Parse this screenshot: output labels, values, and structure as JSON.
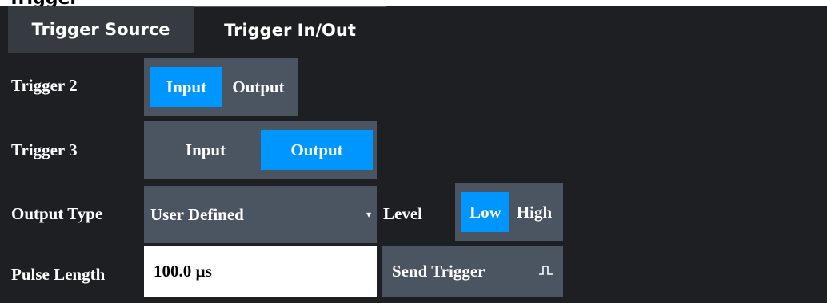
{
  "window": {
    "title_fragment": "Trigger"
  },
  "tabs": [
    {
      "label": "Trigger Source",
      "active": false
    },
    {
      "label": "Trigger In/Out",
      "active": true
    }
  ],
  "trigger2": {
    "label": "Trigger 2",
    "options": [
      "Input",
      "Output"
    ],
    "selected": "Input"
  },
  "trigger3": {
    "label": "Trigger 3",
    "options": [
      "Input",
      "Output"
    ],
    "selected": "Output"
  },
  "output_type": {
    "label": "Output Type",
    "value": "User Defined",
    "caret": "▾"
  },
  "level": {
    "label": "Level",
    "options": [
      "Low",
      "High"
    ],
    "selected": "Low"
  },
  "pulse_length": {
    "label": "Pulse Length",
    "value": "100.0 µs"
  },
  "send_trigger": {
    "label": "Send Trigger",
    "icon": "pulse-icon"
  },
  "colors": {
    "background": "#1d1f22",
    "control": "#4a5561",
    "accent": "#0096ff",
    "text": "#ffffff"
  }
}
